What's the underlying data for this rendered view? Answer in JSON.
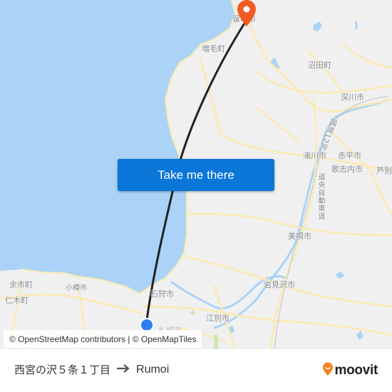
{
  "map": {
    "colors": {
      "land": "#f0f0f0",
      "water": "#aad3f7",
      "road": "#fbeab0",
      "route_line": "#222222",
      "destination_pin": "#f15a22",
      "origin_dot": "#2d7ef0"
    },
    "places": [
      {
        "label": "留萌市",
        "id": "rumoi"
      },
      {
        "label": "増毛町",
        "id": "mashike"
      },
      {
        "label": "沼田町",
        "id": "numata"
      },
      {
        "label": "深川市",
        "id": "fukagawa"
      },
      {
        "label": "国道12号",
        "id": "route12"
      },
      {
        "label": "滝川市",
        "id": "takikawa"
      },
      {
        "label": "赤平市",
        "id": "akabira"
      },
      {
        "label": "歌志内市",
        "id": "utashinai"
      },
      {
        "label": "芦別",
        "id": "ashibetsu"
      },
      {
        "label": "道央自動車道",
        "id": "doo-expressway"
      },
      {
        "label": "美唄市",
        "id": "bibai"
      },
      {
        "label": "岩見沢市",
        "id": "iwamizawa"
      },
      {
        "label": "余市町",
        "id": "yoichi"
      },
      {
        "label": "仁木町",
        "id": "niki"
      },
      {
        "label": "小樽市",
        "id": "otaru"
      },
      {
        "label": "石狩市",
        "id": "ishikari"
      },
      {
        "label": "江別市",
        "id": "ebetsu"
      },
      {
        "label": "札幌市",
        "id": "sapporo"
      }
    ],
    "cta_label": "Take me there",
    "attribution": "© OpenStreetMap contributors | © OpenMapTiles"
  },
  "footer": {
    "origin": "西宮の沢５条１丁目",
    "arrow_icon": "arrow-right-icon",
    "destination": "Rumoi",
    "logo_text": "moovit"
  }
}
